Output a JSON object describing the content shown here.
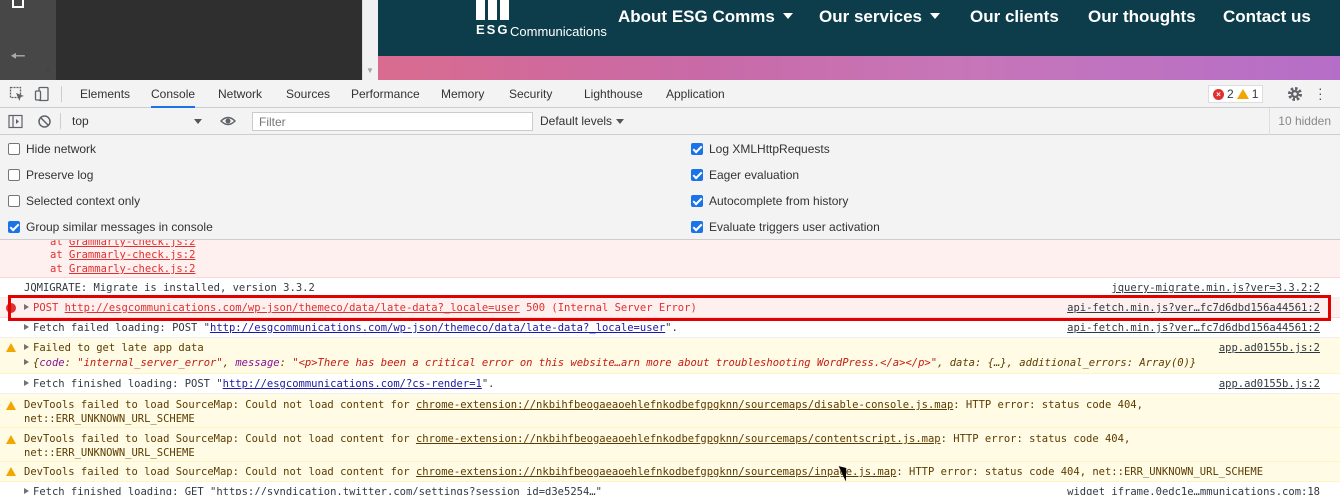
{
  "website": {
    "logo_esg": "ESG",
    "logo_comm": "Communications",
    "nav": [
      {
        "label": "About ESG Comms",
        "dropdown": true
      },
      {
        "label": "Our services",
        "dropdown": true
      },
      {
        "label": "Our clients",
        "dropdown": false
      },
      {
        "label": "Our thoughts",
        "dropdown": false
      },
      {
        "label": "Contact us",
        "dropdown": false
      }
    ]
  },
  "devtools": {
    "tabs": [
      "Elements",
      "Console",
      "Network",
      "Sources",
      "Performance",
      "Memory",
      "Security",
      "Lighthouse",
      "Application"
    ],
    "active_tab": "Console",
    "error_count": "2",
    "warning_count": "1"
  },
  "console_toolbar": {
    "context": "top",
    "filter_placeholder": "Filter",
    "levels": "Default levels",
    "hidden": "10 hidden"
  },
  "settings": {
    "left": [
      {
        "label": "Hide network",
        "checked": false
      },
      {
        "label": "Preserve log",
        "checked": false
      },
      {
        "label": "Selected context only",
        "checked": false
      },
      {
        "label": "Group similar messages in console",
        "checked": true
      }
    ],
    "right": [
      {
        "label": "Log XMLHttpRequests",
        "checked": true
      },
      {
        "label": "Eager evaluation",
        "checked": true
      },
      {
        "label": "Autocomplete from history",
        "checked": true
      },
      {
        "label": "Evaluate triggers user activation",
        "checked": true
      }
    ]
  },
  "messages": {
    "stack_prefix": "at ",
    "stack_file": "Grammarly-check.js:2",
    "jqmigrate": "JQMIGRATE: Migrate is installed, version 3.3.2",
    "jqmigrate_src": "jquery-migrate.min.js?ver=3.3.2:2",
    "post_prefix": "POST ",
    "post_url": "http://esgcommunications.com/wp-json/themeco/data/late-data?_locale=user",
    "post_suffix": " 500 (Internal Server Error)",
    "post_src": "api-fetch.min.js?ver…fc7d6dbd156a44561:2",
    "fetch_failed_prefix": "Fetch failed loading: POST \"",
    "fetch_failed_url": "http://esgcommunications.com/wp-json/themeco/data/late-data?_locale=user",
    "fetch_failed_suffix": "\".",
    "fetch_failed_src": "api-fetch.min.js?ver…fc7d6dbd156a44561:2",
    "late_app": "Failed to get late app data",
    "late_app_src": "app.ad0155b.js:2",
    "obj_code_key": "code",
    "obj_code_val": "\"internal_server_error\"",
    "obj_msg_key": "message",
    "obj_msg_val": "\"<p>There has been a critical error on this website…arn more about troubleshooting WordPress.</a></p>\"",
    "obj_rest": ", data: {…}, additional_errors: Array(0)}",
    "fetch_finished_prefix": "Fetch finished loading: POST \"",
    "fetch_finished_url": "http://esgcommunications.com/?cs-render=1",
    "fetch_finished_suffix": "\".",
    "fetch_finished_src": "app.ad0155b.js:2",
    "sm_prefix": "DevTools failed to load SourceMap: Could not load content for ",
    "sm1_url": "chrome-extension://nkbihfbeogaeaoehlefnkodbefgpgknn/sourcemaps/disable-console.js.map",
    "sm2_url": "chrome-extension://nkbihfbeogaeaoehlefnkodbefgpgknn/sourcemaps/contentscript.js.map",
    "sm3_url": "chrome-extension://nkbihfbeogaeaoehlefnkodbefgpgknn/sourcemaps/inpage.js.map",
    "sm_suffix": ": HTTP error: status code 404,",
    "sm_suffix2": "net::ERR_UNKNOWN_URL_SCHEME",
    "sm3_suffix": ": HTTP error: status code 404, net::ERR_UNKNOWN_URL_SCHEME",
    "last": "Fetch finished loading: GET \"https://syndication.twitter.com/settings?session_id=d3e5254…\"",
    "last_src": "widget_iframe.0edc1e…mmunications.com:18"
  },
  "colors": {
    "error": "#e0302f",
    "warning": "#f2a600",
    "accent": "#1a73e8",
    "site_header": "#0d3d4b",
    "highlight_box": "#e00000"
  }
}
